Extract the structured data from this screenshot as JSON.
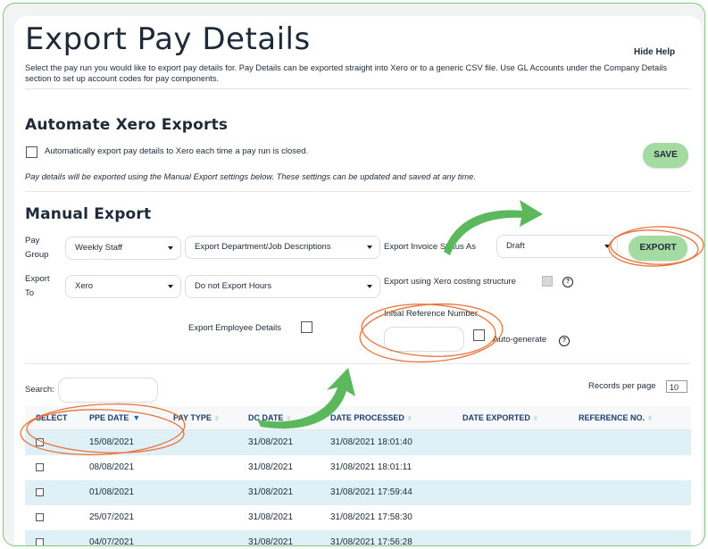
{
  "page": {
    "title": "Export Pay Details",
    "hide_help": "Hide Help",
    "intro": "Select the pay run you would like to export pay details for. Pay Details can be exported straight into Xero or to a generic CSV file. Use GL Accounts under the Company Details section to set up account codes for pay components."
  },
  "automate": {
    "heading": "Automate Xero Exports",
    "checkbox_label": "Automatically export pay details to Xero each time a pay run is closed.",
    "save_label": "SAVE",
    "note": "Pay details will be exported using the Manual Export settings below. These settings can be updated and saved at any time."
  },
  "manual": {
    "heading": "Manual Export",
    "pay_group_label_1": "Pay",
    "pay_group_label_2": "Group",
    "pay_group_value": "Weekly Staff",
    "export_dept_value": "Export Department/Job Descriptions",
    "invoice_status_label": "Export Invoice Status As",
    "invoice_status_value": "Draft",
    "export_label": "EXPORT",
    "export_to_label_1": "Export",
    "export_to_label_2": "To",
    "export_to_value": "Xero",
    "hours_value": "Do not Export Hours",
    "costing_label": "Export using Xero costing structure",
    "employee_details_label": "Export Employee Details",
    "initial_ref_label": "Initial Reference Number",
    "initial_ref_value": "",
    "auto_generate_label": "Auto-generate",
    "help_glyph": "?"
  },
  "table": {
    "search_label": "Search:",
    "search_value": "",
    "records_label": "Records per page",
    "records_value": "10",
    "columns": [
      "SELECT",
      "PPE DATE",
      "PAY TYPE",
      "DC DATE",
      "DATE PROCESSED",
      "DATE EXPORTED",
      "REFERENCE NO."
    ],
    "rows": [
      {
        "ppe": "15/08/2021",
        "pay_type": "",
        "dc": "31/08/2021",
        "processed": "31/08/2021 18:01:40",
        "exported": "",
        "ref": ""
      },
      {
        "ppe": "08/08/2021",
        "pay_type": "",
        "dc": "31/08/2021",
        "processed": "31/08/2021 18:01:11",
        "exported": "",
        "ref": ""
      },
      {
        "ppe": "01/08/2021",
        "pay_type": "",
        "dc": "31/08/2021",
        "processed": "31/08/2021 17:59:44",
        "exported": "",
        "ref": ""
      },
      {
        "ppe": "25/07/2021",
        "pay_type": "",
        "dc": "31/08/2021",
        "processed": "31/08/2021 17:58:30",
        "exported": "",
        "ref": ""
      },
      {
        "ppe": "04/07/2021",
        "pay_type": "",
        "dc": "31/08/2021",
        "processed": "31/08/2021 17:56:28",
        "exported": "",
        "ref": ""
      }
    ]
  },
  "colors": {
    "accent_green": "#a3dba1",
    "annotation_orange": "#e8733a",
    "arrow_green": "#5cb85c",
    "row_highlight": "#dff0f7",
    "header_text": "#1b3d6e"
  }
}
